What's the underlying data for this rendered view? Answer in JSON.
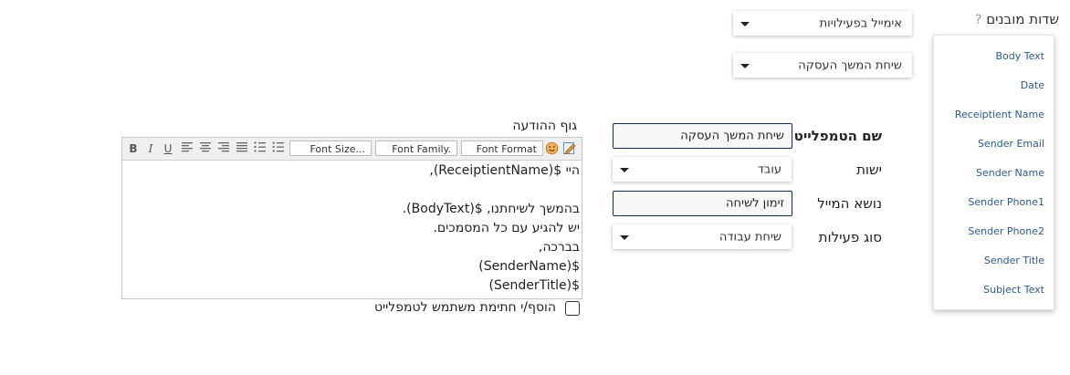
{
  "structured_fields": {
    "title": "שדות מובנים",
    "help_icon": "?",
    "items": [
      "Body Text",
      "Date",
      "Receiptient Name",
      "Sender Email",
      "Sender Name",
      "Sender Phone1",
      "Sender Phone2",
      "Sender Title",
      "Subject Text"
    ]
  },
  "top_dropdowns": {
    "activity_email": "אימייל בפעילויות",
    "followup_call": "שיחת המשך העסקה"
  },
  "form": {
    "template_name_label": "שם הטמפלייט",
    "template_name_value": "שיחת המשך העסקה",
    "entity_label": "ישות",
    "entity_value": "עובד",
    "email_subject_label": "נושא המייל",
    "email_subject_value": "זימון לשיחה",
    "activity_type_label": "סוג פעילות",
    "activity_type_value": "שיחת עבודה"
  },
  "editor": {
    "label": "גוף ההודעה",
    "toolbar": {
      "bold": "B",
      "italic": "I",
      "underline": "U",
      "font_size": "Font Size...",
      "font_family": "Font Family.",
      "font_format": "Font Format"
    },
    "lines": [
      "היי $(ReceiptientName),",
      "",
      "בהמשך לשיחתנו, $(BodyText).",
      "יש להגיע עם כל המסמכים.",
      "בברכה,",
      "$(SenderName)",
      "$(SenderTitle)"
    ]
  },
  "signature_checkbox_label": "הוסף/י חתימת משתמש לטמפלייט"
}
